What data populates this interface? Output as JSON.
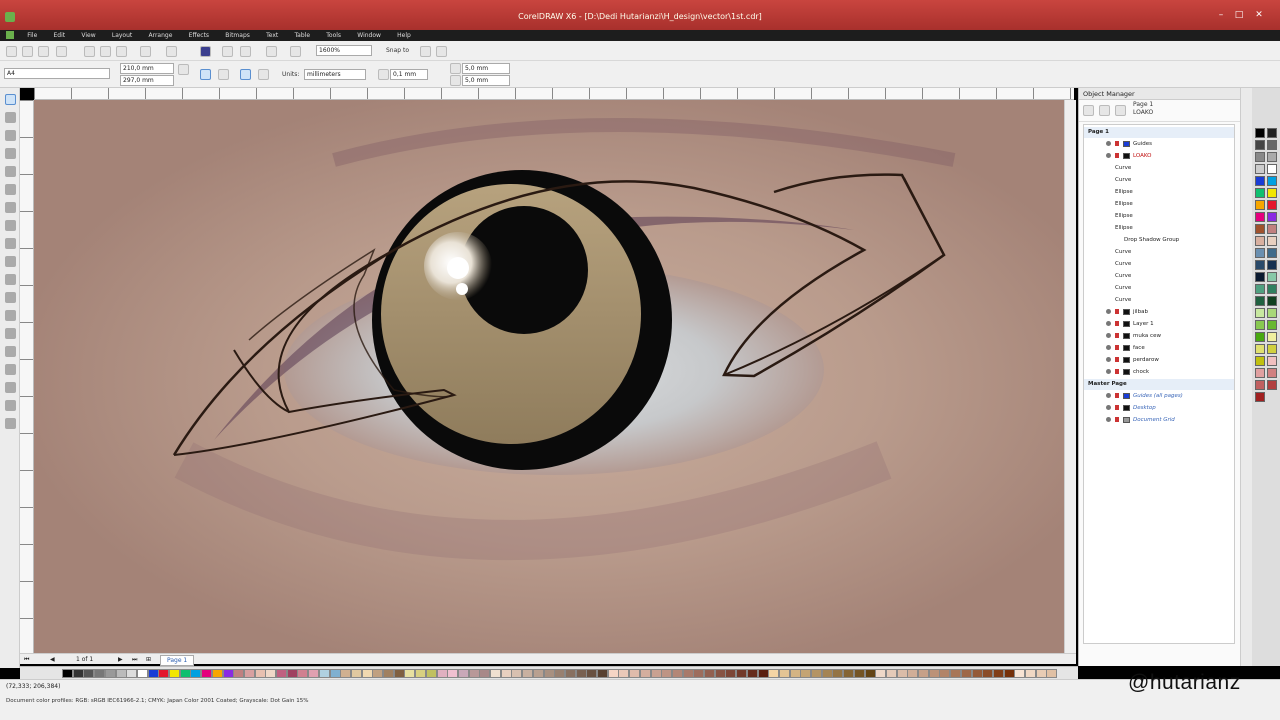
{
  "window": {
    "title": "CorelDRAW X6 - [D:\\Dedi Hutarianzi\\H_design\\vector\\1st.cdr]"
  },
  "menu": [
    "File",
    "Edit",
    "View",
    "Layout",
    "Arrange",
    "Effects",
    "Bitmaps",
    "Text",
    "Table",
    "Tools",
    "Window",
    "Help"
  ],
  "toolbar": {
    "zoom": "1600%",
    "snap_label": "Snap to"
  },
  "propbar": {
    "preset": "A4",
    "width": "210,0 mm",
    "height": "297,0 mm",
    "units_label": "Units:",
    "units_value": "millimeters",
    "nudge": "0,1 mm",
    "dup_x": "5,0 mm",
    "dup_y": "5,0 mm"
  },
  "pagenav": {
    "counter": "1 of 1",
    "page_tab": "Page 1"
  },
  "object_manager": {
    "title": "Object Manager",
    "page_info": "Page 1",
    "layer_info": "LOAKO",
    "items": [
      {
        "label": "Page 1",
        "level": 0,
        "style": "bold",
        "swatch": ""
      },
      {
        "label": "Guides",
        "level": 2,
        "style": "normal",
        "swatch": "#1a3dd6"
      },
      {
        "label": "LOAKO",
        "level": 2,
        "style": "red",
        "swatch": "#111111"
      },
      {
        "label": "Curve",
        "level": 3,
        "style": "normal",
        "swatch": ""
      },
      {
        "label": "Curve",
        "level": 3,
        "style": "normal",
        "swatch": ""
      },
      {
        "label": "Ellipse",
        "level": 3,
        "style": "normal",
        "swatch": ""
      },
      {
        "label": "Ellipse",
        "level": 3,
        "style": "normal",
        "swatch": ""
      },
      {
        "label": "Ellipse",
        "level": 3,
        "style": "normal",
        "swatch": ""
      },
      {
        "label": "Ellipse",
        "level": 3,
        "style": "normal",
        "swatch": ""
      },
      {
        "label": "Drop Shadow Group",
        "level": 4,
        "style": "normal",
        "swatch": ""
      },
      {
        "label": "Curve",
        "level": 3,
        "style": "normal",
        "swatch": ""
      },
      {
        "label": "Curve",
        "level": 3,
        "style": "normal",
        "swatch": ""
      },
      {
        "label": "Curve",
        "level": 3,
        "style": "normal",
        "swatch": ""
      },
      {
        "label": "Curve",
        "level": 3,
        "style": "normal",
        "swatch": ""
      },
      {
        "label": "Curve",
        "level": 3,
        "style": "normal",
        "swatch": ""
      },
      {
        "label": "jilbab",
        "level": 2,
        "style": "normal",
        "swatch": "#111111"
      },
      {
        "label": "Layer 1",
        "level": 2,
        "style": "normal",
        "swatch": "#111111"
      },
      {
        "label": "muka cew",
        "level": 2,
        "style": "normal",
        "swatch": "#111111"
      },
      {
        "label": "face",
        "level": 2,
        "style": "normal",
        "swatch": "#111111"
      },
      {
        "label": "perdarow",
        "level": 2,
        "style": "normal",
        "swatch": "#111111"
      },
      {
        "label": "chock",
        "level": 2,
        "style": "normal",
        "swatch": "#111111"
      },
      {
        "label": "Master Page",
        "level": 0,
        "style": "bold",
        "swatch": ""
      },
      {
        "label": "Guides (all pages)",
        "level": 2,
        "style": "blue",
        "swatch": "#1a3dd6"
      },
      {
        "label": "Desktop",
        "level": 2,
        "style": "blue",
        "swatch": "#111111"
      },
      {
        "label": "Document Grid",
        "level": 2,
        "style": "blue",
        "swatch": "#999999"
      }
    ]
  },
  "status": {
    "coords": "(72,333; 206,384)",
    "profiles": "Document color profiles: RGB: sRGB IEC61966-2.1; CMYK: Japan Color 2001 Coated; Grayscale: Dot Gain 15%"
  },
  "watermark": "@hutarianz",
  "colors": {
    "title_bar": "#b8362f",
    "iris": "#a38d6c",
    "pupil": "#0a0a0a",
    "outline": "#2a1a12"
  }
}
